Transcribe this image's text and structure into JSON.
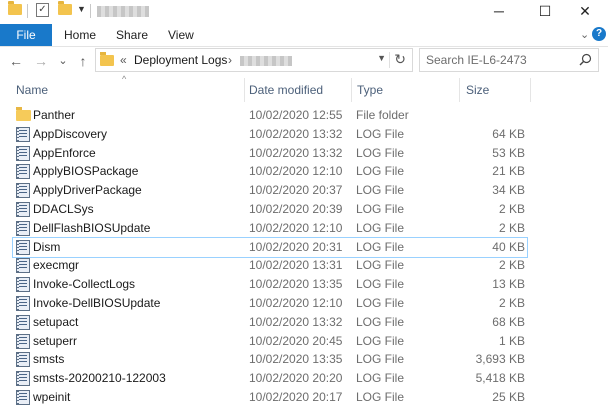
{
  "window": {
    "quick_access_icons": [
      "folder-icon",
      "properties-checkbox-icon",
      "new-folder-icon"
    ],
    "minimize_icon": "─",
    "maximize_icon": "☐",
    "close_icon": "✕"
  },
  "ribbon": {
    "tabs": [
      {
        "label": "File",
        "active": true
      },
      {
        "label": "Home"
      },
      {
        "label": "Share"
      },
      {
        "label": "View"
      }
    ],
    "accent_color": "#1979ca"
  },
  "navigation": {
    "back_icon": "←",
    "forward_icon": "→",
    "recent_icon": "⌄",
    "up_icon": "↑"
  },
  "address": {
    "prefix": "«",
    "crumbs": [
      "Deployment Logs"
    ],
    "separator": "›"
  },
  "search": {
    "placeholder": "Search IE-L6-2473"
  },
  "columns": {
    "name": "Name",
    "date": "Date modified",
    "type": "Type",
    "size": "Size"
  },
  "files": [
    {
      "name": "Panther",
      "date": "10/02/2020 12:55",
      "type": "File folder",
      "size": "",
      "icon": "folder-icon"
    },
    {
      "name": "AppDiscovery",
      "date": "10/02/2020 13:32",
      "type": "LOG File",
      "size": "64 KB",
      "icon": "log-file-icon"
    },
    {
      "name": "AppEnforce",
      "date": "10/02/2020 13:32",
      "type": "LOG File",
      "size": "53 KB",
      "icon": "log-file-icon"
    },
    {
      "name": "ApplyBIOSPackage",
      "date": "10/02/2020 12:10",
      "type": "LOG File",
      "size": "21 KB",
      "icon": "log-file-icon"
    },
    {
      "name": "ApplyDriverPackage",
      "date": "10/02/2020 20:37",
      "type": "LOG File",
      "size": "34 KB",
      "icon": "log-file-icon"
    },
    {
      "name": "DDACLSys",
      "date": "10/02/2020 20:39",
      "type": "LOG File",
      "size": "2 KB",
      "icon": "log-file-icon"
    },
    {
      "name": "DellFlashBIOSUpdate",
      "date": "10/02/2020 12:10",
      "type": "LOG File",
      "size": "2 KB",
      "icon": "log-file-icon"
    },
    {
      "name": "Dism",
      "date": "10/02/2020 20:31",
      "type": "LOG File",
      "size": "40 KB",
      "icon": "log-file-icon",
      "selected": true
    },
    {
      "name": "execmgr",
      "date": "10/02/2020 13:31",
      "type": "LOG File",
      "size": "2 KB",
      "icon": "log-file-icon"
    },
    {
      "name": "Invoke-CollectLogs",
      "date": "10/02/2020 13:35",
      "type": "LOG File",
      "size": "13 KB",
      "icon": "log-file-icon"
    },
    {
      "name": "Invoke-DellBIOSUpdate",
      "date": "10/02/2020 12:10",
      "type": "LOG File",
      "size": "2 KB",
      "icon": "log-file-icon"
    },
    {
      "name": "setupact",
      "date": "10/02/2020 13:32",
      "type": "LOG File",
      "size": "68 KB",
      "icon": "log-file-icon"
    },
    {
      "name": "setuperr",
      "date": "10/02/2020 20:45",
      "type": "LOG File",
      "size": "1 KB",
      "icon": "log-file-icon"
    },
    {
      "name": "smsts",
      "date": "10/02/2020 13:35",
      "type": "LOG File",
      "size": "3,693 KB",
      "icon": "log-file-icon"
    },
    {
      "name": "smsts-20200210-122003",
      "date": "10/02/2020 20:20",
      "type": "LOG File",
      "size": "5,418 KB",
      "icon": "log-file-icon"
    },
    {
      "name": "wpeinit",
      "date": "10/02/2020 20:17",
      "type": "LOG File",
      "size": "25 KB",
      "icon": "log-file-icon"
    }
  ]
}
